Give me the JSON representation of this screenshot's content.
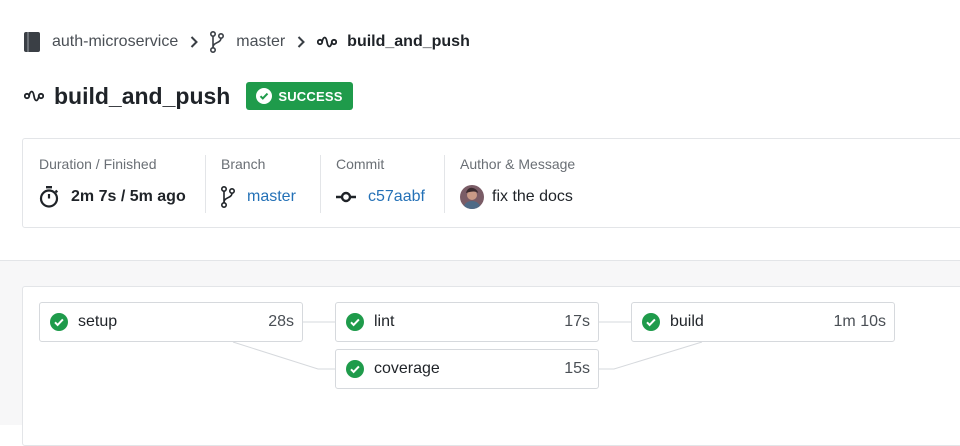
{
  "breadcrumb": {
    "repo": "auth-microservice",
    "branch": "master",
    "workflow": "build_and_push"
  },
  "header": {
    "title": "build_and_push",
    "status": "SUCCESS"
  },
  "info": {
    "duration_label": "Duration / Finished",
    "duration_value": "2m 7s / 5m ago",
    "branch_label": "Branch",
    "branch_value": "master",
    "commit_label": "Commit",
    "commit_value": "c57aabf",
    "author_label": "Author & Message",
    "author_message": "fix the docs"
  },
  "jobs": [
    {
      "name": "setup",
      "duration": "28s"
    },
    {
      "name": "lint",
      "duration": "17s"
    },
    {
      "name": "coverage",
      "duration": "15s"
    },
    {
      "name": "build",
      "duration": "1m 10s"
    }
  ],
  "colors": {
    "success": "#1f9b4b",
    "link": "#2471b7",
    "border": "#e3e5e8"
  },
  "icons": {
    "repo": "book-icon",
    "branch": "branch-icon",
    "workflow": "workflow-icon",
    "success": "check-circle-icon",
    "duration": "stopwatch-icon",
    "commit": "commit-icon"
  }
}
